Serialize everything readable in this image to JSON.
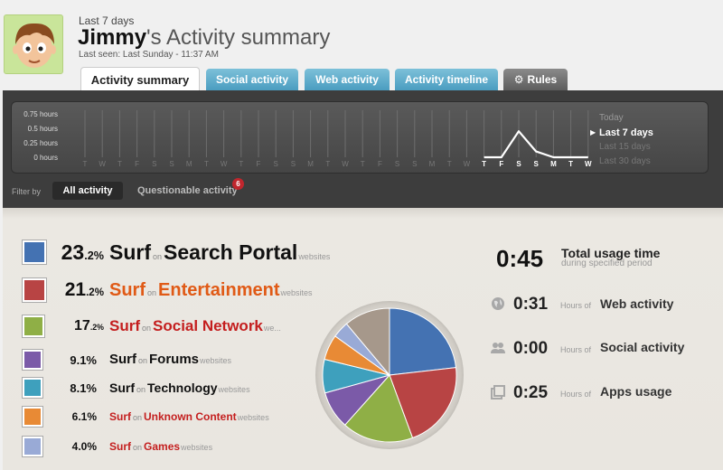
{
  "header": {
    "period": "Last 7 days",
    "user_name": "Jimmy",
    "title_suffix": "'s Activity summary",
    "last_seen": "Last seen: Last Sunday - 11:37 AM"
  },
  "tabs": [
    {
      "label": "Activity summary",
      "active": true
    },
    {
      "label": "Social activity"
    },
    {
      "label": "Web activity"
    },
    {
      "label": "Activity timeline"
    },
    {
      "label": "Rules"
    }
  ],
  "chart_data": {
    "type": "line",
    "title": "",
    "xlabel": "",
    "ylabel": "",
    "y_ticks": [
      "0.75 hours",
      "0.5 hours",
      "0.25 hours",
      "0 hours"
    ],
    "ylim": [
      0,
      0.75
    ],
    "x": [
      "T",
      "W",
      "T",
      "F",
      "S",
      "S",
      "M",
      "T",
      "W",
      "T",
      "F",
      "S",
      "S",
      "M",
      "T",
      "W",
      "T",
      "F",
      "S",
      "S",
      "M",
      "T",
      "W",
      "T",
      "F",
      "S",
      "S",
      "M",
      "T",
      "W"
    ],
    "highlight_from_index": 23,
    "series": [
      {
        "values": [
          0,
          0,
          0,
          0,
          0,
          0,
          0,
          0,
          0,
          0,
          0,
          0,
          0,
          0,
          0,
          0,
          0,
          0,
          0,
          0,
          0,
          0,
          0,
          0,
          0,
          0.45,
          0.1,
          0,
          0,
          0
        ]
      }
    ],
    "grid": true
  },
  "periods": [
    "Today",
    "Last 7 days",
    "Last 15 days",
    "Last 30 days"
  ],
  "selected_period": "Last 7 days",
  "filter": {
    "label": "Filter by",
    "all": "All activity",
    "questionable": "Questionable activity",
    "questionable_count": "6"
  },
  "categories": [
    {
      "pct_int": "23",
      "pct_dec": ".2%",
      "surf": "Surf",
      "on": "on",
      "name": "Search Portal",
      "suffix": "websites",
      "color": "#4472b2",
      "name_color": "#111111",
      "value": 23.2
    },
    {
      "pct_int": "21",
      "pct_dec": ".2%",
      "surf": "Surf",
      "on": "on",
      "name": "Entertainment",
      "suffix": "websites",
      "color": "#b84444",
      "name_color": "#e05a16",
      "value": 21.2
    },
    {
      "pct_int": "17",
      "pct_dec": ".2%",
      "surf": "Surf",
      "on": "on",
      "name": "Social Network",
      "suffix": "we...",
      "color": "#8faf46",
      "name_color": "#c41e1e",
      "value": 17.2
    },
    {
      "pct_int": "9.1%",
      "pct_dec": "",
      "surf": "Surf",
      "on": "on",
      "name": "Forums",
      "suffix": "websites",
      "color": "#7b5aa8",
      "name_color": "#111111",
      "value": 9.1
    },
    {
      "pct_int": "8.1%",
      "pct_dec": "",
      "surf": "Surf",
      "on": "on",
      "name": "Technology",
      "suffix": "websites",
      "color": "#3ea0bd",
      "name_color": "#111111",
      "value": 8.1
    },
    {
      "pct_int": "6.1%",
      "pct_dec": "",
      "surf": "Surf",
      "on": "on",
      "name": "Unknown Content",
      "suffix": "websites",
      "color": "#e88a35",
      "name_color": "#c41e1e",
      "value": 6.1
    },
    {
      "pct_int": "4.0%",
      "pct_dec": "",
      "surf": "Surf",
      "on": "on",
      "name": "Games",
      "suffix": "websites",
      "color": "#99aad6",
      "name_color": "#c41e1e",
      "value": 4.0
    }
  ],
  "pie_other": {
    "color": "#a6988b",
    "value": 11.1
  },
  "total": {
    "value": "0:45",
    "label": "Total usage time",
    "sub": "during specified period"
  },
  "stats": [
    {
      "value": "0:31",
      "unit": "Hours of",
      "label": "Web activity",
      "icon": "globe-icon"
    },
    {
      "value": "0:00",
      "unit": "Hours of",
      "label": "Social activity",
      "icon": "people-icon"
    },
    {
      "value": "0:25",
      "unit": "Hours of",
      "label": "Apps usage",
      "icon": "windows-icon"
    }
  ]
}
